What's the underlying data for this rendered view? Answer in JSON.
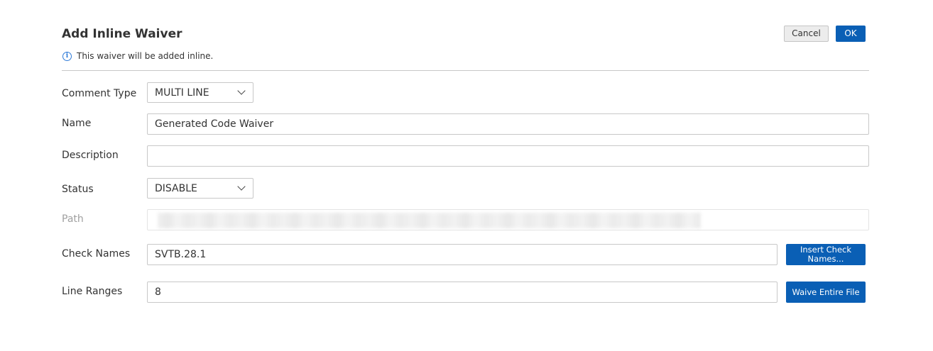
{
  "dialog": {
    "title": "Add Inline Waiver",
    "info_text": "This waiver will be added inline.",
    "info_icon": "info-icon",
    "cancel_label": "Cancel",
    "ok_label": "OK"
  },
  "form": {
    "comment_type": {
      "label": "Comment Type",
      "value": "MULTI LINE"
    },
    "name": {
      "label": "Name",
      "value": "Generated Code Waiver"
    },
    "description": {
      "label": "Description",
      "value": ""
    },
    "status": {
      "label": "Status",
      "value": "DISABLE"
    },
    "path": {
      "label": "Path"
    },
    "check_names": {
      "label": "Check Names",
      "value": "SVTB.28.1",
      "button_label": "Insert Check Names..."
    },
    "line_ranges": {
      "label": "Line Ranges",
      "value": "8",
      "button_label": "Waive Entire File"
    }
  },
  "colors": {
    "primary_button": "#0a5fb5",
    "info_icon": "#2f7bd8",
    "disabled_label": "#a0a0a0"
  }
}
